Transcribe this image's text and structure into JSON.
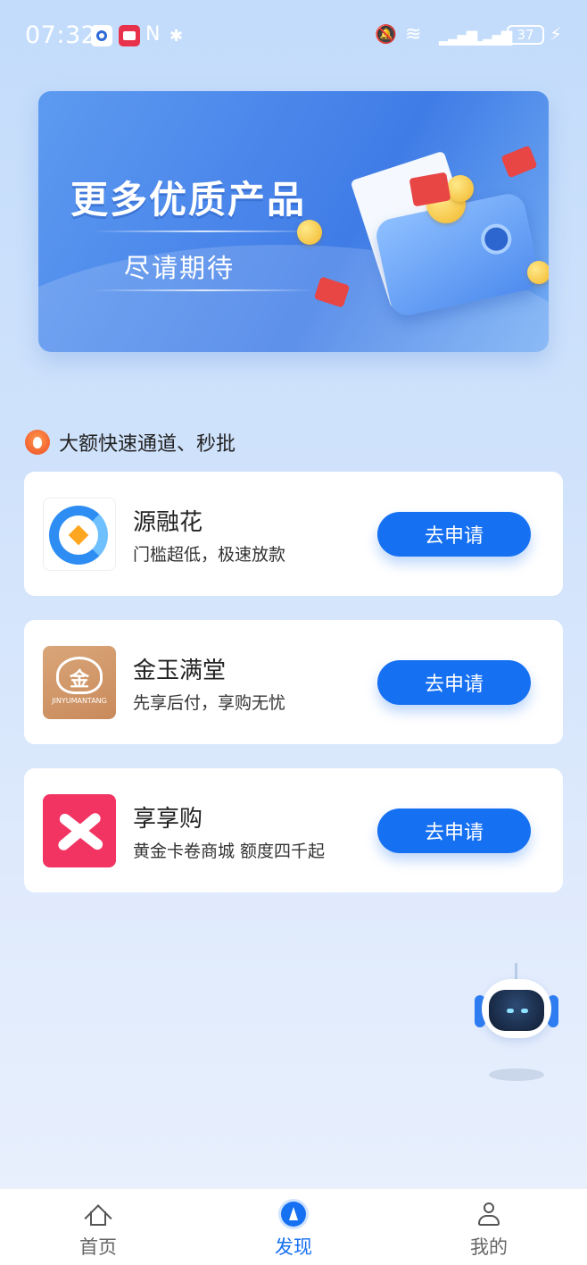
{
  "status_bar": {
    "time": "07:32",
    "battery": "37",
    "nfc_glyph": "N",
    "bluetooth_glyph": "✱",
    "mute_glyph": "🔕",
    "wifi_glyph": "≋",
    "signal_glyph": "▂▃▅▇"
  },
  "banner": {
    "title": "更多优质产品",
    "subtitle": "尽请期待"
  },
  "section": {
    "title": "大额快速通道、秒批"
  },
  "products": [
    {
      "name": "源融花",
      "desc": "门槛超低，极速放款",
      "button": "去申请",
      "logo_icon": "yuanronghua-logo"
    },
    {
      "name": "金玉满堂",
      "desc": "先享后付，享购无忧",
      "button": "去申请",
      "logo_icon": "jinyumantang-logo",
      "logo_text": "金玉满堂",
      "logo_subtext": "JINYUMANTANG"
    },
    {
      "name": "享享购",
      "desc": "黄金卡卷商城 额度四千起",
      "button": "去申请",
      "logo_icon": "xiangxianggou-logo"
    }
  ],
  "bottom_nav": {
    "items": [
      {
        "label": "首页",
        "icon": "home-icon",
        "active": false
      },
      {
        "label": "发现",
        "icon": "discover-icon",
        "active": true
      },
      {
        "label": "我的",
        "icon": "user-icon",
        "active": false
      }
    ]
  },
  "colors": {
    "accent": "#1670f2",
    "background_top": "#c3dcfb",
    "card": "#ffffff"
  }
}
